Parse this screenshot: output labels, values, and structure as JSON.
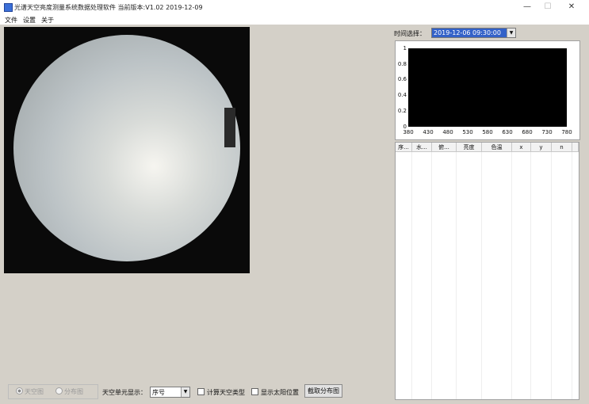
{
  "window": {
    "title": "光谱天空亮度测量系统数据处理软件   当前版本:V1.02   2019-12-09",
    "minimize_glyph": "—",
    "maximize_glyph": "☐",
    "close_glyph": "✕"
  },
  "menu": [
    "文件",
    "设置",
    "关于"
  ],
  "time_select": {
    "label": "时间选择：",
    "value": "2019-12-06 09:30:00",
    "arrow": "▼"
  },
  "chart": {
    "y_ticks": [
      "1",
      "0.8",
      "0.6",
      "0.4",
      "0.2",
      "0"
    ],
    "x_ticks": [
      "380",
      "430",
      "480",
      "530",
      "580",
      "630",
      "680",
      "730",
      "780"
    ]
  },
  "chart_data": {
    "type": "line",
    "title": "",
    "xlabel": "",
    "ylabel": "",
    "xlim": [
      380,
      780
    ],
    "ylim": [
      0,
      1
    ],
    "x_ticks": [
      380,
      430,
      480,
      530,
      580,
      630,
      680,
      730,
      780
    ],
    "y_ticks": [
      0,
      0.2,
      0.4,
      0.6,
      0.8,
      1
    ],
    "series": [],
    "plot_background": "#000000"
  },
  "table": {
    "columns": [
      "序...",
      "水...",
      "俯...",
      "亮度",
      "色温",
      "x",
      "y",
      "n"
    ]
  },
  "bottom": {
    "radio_1": "天空图",
    "radio_2": "分布图",
    "cell_label": "天空单元显示：",
    "cell_select_value": "序号",
    "cell_select_arrow": "▼",
    "check_sky_type": "计算天空类型",
    "check_sun_pos": "显示太阳位置",
    "capture_button": "截取分布图"
  },
  "colors": {
    "accent": "#3361c8",
    "window_bg": "#d4d0c8",
    "plot_bg": "#000000"
  }
}
